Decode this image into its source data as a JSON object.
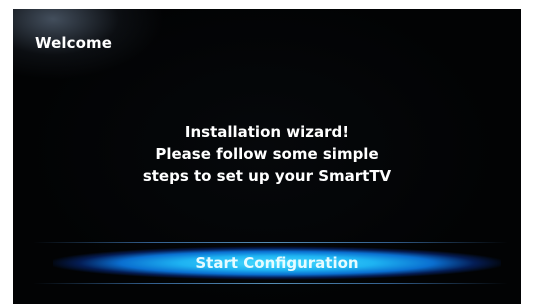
{
  "window": {
    "title": "Welcome"
  },
  "message": {
    "lines": [
      "Installation wizard!",
      "Please follow some simple",
      "steps to set up your SmartTV"
    ]
  },
  "actions": {
    "start_label": "Start Configuration"
  },
  "colors": {
    "background": "#030406",
    "text": "#ffffff",
    "button_highlight": "#1eb3f2"
  }
}
